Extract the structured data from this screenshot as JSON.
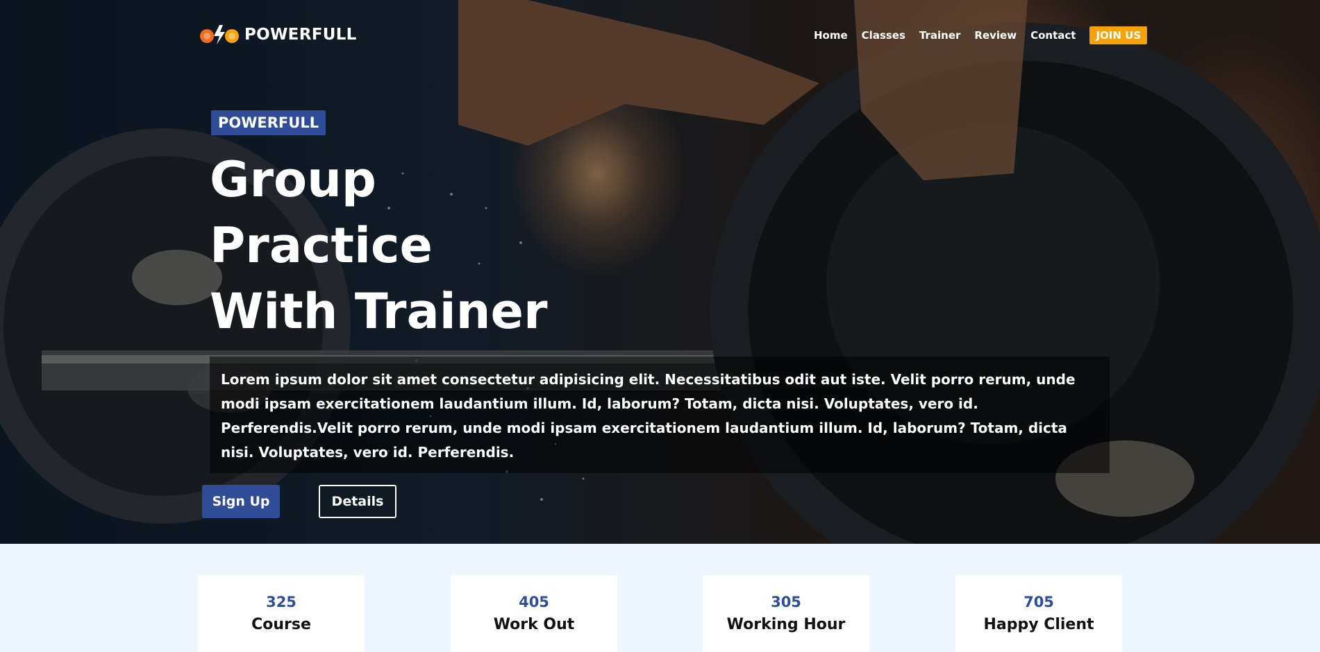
{
  "brand": {
    "name": "POWERFULL"
  },
  "nav": {
    "items": [
      "Home",
      "Classes",
      "Trainer",
      "Review",
      "Contact"
    ],
    "join_label": "JOIN US"
  },
  "hero": {
    "badge": "POWERFULL",
    "headline": [
      "Group",
      "Practice",
      "With Trainer"
    ],
    "description": "Lorem ipsum dolor sit amet consectetur adipisicing elit. Necessitatibus odit aut iste. Velit porro rerum, unde modi ipsam exercitationem laudantium illum. Id, laborum? Totam, dicta nisi. Voluptates, vero id. Perferendis.Velit porro rerum, unde modi ipsam exercitationem laudantium illum. Id, laborum? Totam, dicta nisi. Voluptates, vero id. Perferendis.",
    "signup_label": "Sign Up",
    "details_label": "Details"
  },
  "stats": [
    {
      "value": "325",
      "label": "Course"
    },
    {
      "value": "405",
      "label": "Work Out"
    },
    {
      "value": "305",
      "label": "Working Hour"
    },
    {
      "value": "705",
      "label": "Happy Client"
    }
  ],
  "colors": {
    "accent": "#2f4d97",
    "join": "#f5a20b",
    "stats_bg": "#eef6ff"
  }
}
